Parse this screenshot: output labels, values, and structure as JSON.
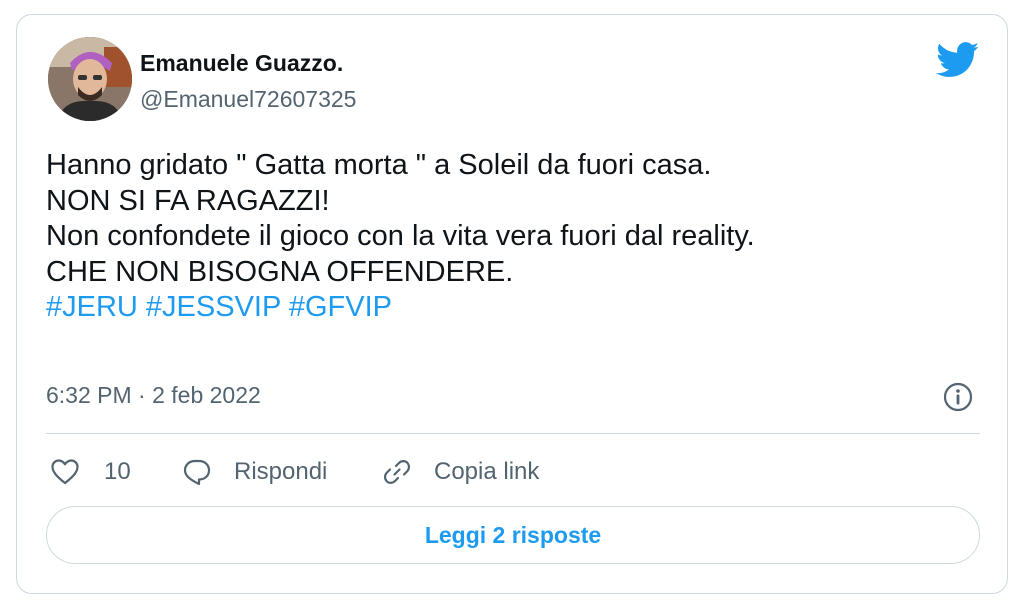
{
  "author": {
    "name": "Emanuele Guazzo.",
    "handle": "@Emanuel72607325"
  },
  "tweet": {
    "lines": [
      "Hanno gridato \" Gatta morta \" a Soleil da fuori casa.",
      "NON SI FA RAGAZZI!",
      "Non confondete il gioco con la vita vera fuori dal reality.",
      "CHE NON BISOGNA OFFENDERE."
    ],
    "hashtags": [
      "#JERU",
      "#JESSVIP",
      "#GFVIP"
    ],
    "timestamp": "6:32 PM · 2 feb 2022"
  },
  "actions": {
    "like_count": "10",
    "reply_label": "Rispondi",
    "copy_link_label": "Copia link"
  },
  "read_replies_label": "Leggi 2 risposte",
  "colors": {
    "accent": "#1d9bf0",
    "text": "#0f1419",
    "secondary_text": "#536471",
    "border": "#cfd9de"
  },
  "icons": {
    "brand": "twitter-bird-icon",
    "info": "info-icon",
    "like": "heart-icon",
    "reply": "reply-bubble-icon",
    "copy_link": "link-icon"
  }
}
